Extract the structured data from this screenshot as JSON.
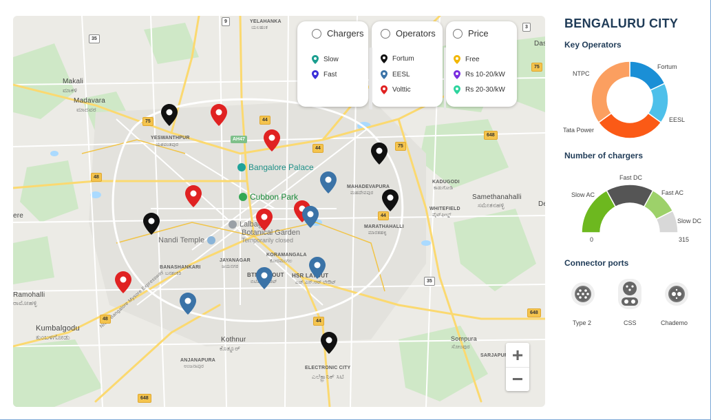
{
  "map": {
    "labels": {
      "yelahanka": "YELAHANKA",
      "yelahanka_kn": "ಯಲಹಂಕ",
      "makali": "Makali",
      "makali_kn": "ಮಾಕಳಿ",
      "madavara": "Madavara",
      "madavara_kn": "ಮಾದವರ",
      "yeswanthpur": "YESWANTHPUR",
      "yeswanthpur_kn": "ಯಶವಂತಪುರ",
      "mahadevapura": "MAHADEVAPURA",
      "mahadevapura_kn": "ಮಹದೇವಪುರ",
      "kadugodi": "KADUGODI",
      "kadugodi_kn": "ಕಾಡುಗೋಡಿ",
      "whitefield": "WHITEFIELD",
      "whitefield_kn": "ವೈಟ್‌ಫೀಲ್ಡ್",
      "samethanahalli": "Samethanahalli",
      "samethanahalli_kn": "ಸಮೇತನಹಳ್ಳಿ",
      "marathahalli": "MARATHAHALLI",
      "marathahalli_kn": "ಮಾರತಹಳ್ಳಿ",
      "banashankari": "BANASHANKARI",
      "banashankari_kn": "ಬನಶಂಕರಿ",
      "jayanagar": "JAYANAGAR",
      "jayanagar_kn": "ಜಯನಗರ",
      "koramangala": "KORAMANGALA",
      "koramangala_kn": "ಕೋರಮಂಗಲ",
      "btm": "BTM LAYOUT",
      "btm_kn": "ಬಿಟಿಎಂ ಲೇಔಟ್",
      "hsr": "HSR LAYOUT",
      "hsr_kn": "ಎಚ್‌.ಎಸ್‌.ಆರ್ ಲೇಔಟ್",
      "ramohalli": "Ramohalli",
      "ramohalli_kn": "ರಾಮೋಹಳ್ಳಿ",
      "kumbalgodu": "Kumbalgodu",
      "kumbalgodu_kn": "ಕುಂಬಳಗೋಡು",
      "kothnur": "Kothnur",
      "kothnur_kn": "ಕೊತ್ನೂರ್",
      "anjanapura": "ANJANAPURA",
      "anjanapura_kn": "ಅಂಜನಾಪುರ",
      "electronic_city": "ELECTRONIC CITY",
      "electronic_city_kn": "ಎಲೆಕ್ಟ್ರಾನಿಕ್ ಸಿಟಿ",
      "sompura": "Sompura",
      "sompura_kn": "ಸೋಂಪುರ",
      "sarjapur": "SARJAPUR",
      "nice_road": "NICE Bangalore Mysore Expressway",
      "das": "Das",
      "ere": "ere",
      "de": "De"
    },
    "pois": {
      "palace": "Bangalore Palace",
      "cubbon": "Cubbon Park",
      "lalbagh_1": "Lalbagh",
      "lalbagh_2": "Botanical Garden",
      "lalbagh_sub": "Temporarily closed",
      "nandi": "Nandi Temple"
    },
    "shields": [
      "9",
      "75",
      "44",
      "AH47",
      "44",
      "75",
      "48",
      "44",
      "35",
      "48",
      "648",
      "648",
      "648",
      "75",
      "44",
      "3",
      "35"
    ],
    "zoom": {
      "in": "+",
      "out": "−"
    }
  },
  "legend": {
    "chargers": {
      "title": "Chargers",
      "items": [
        {
          "label": "Slow",
          "color": "#1a9e8f"
        },
        {
          "label": "Fast",
          "color": "#3b2fd9"
        }
      ]
    },
    "operators": {
      "title": "Operators",
      "items": [
        {
          "label": "Fortum",
          "color": "#111111"
        },
        {
          "label": "EESL",
          "color": "#3b73a7"
        },
        {
          "label": "Volttic",
          "color": "#e02222"
        }
      ]
    },
    "price": {
      "title": "Price",
      "items": [
        {
          "label": "Free",
          "color": "#f2b705"
        },
        {
          "label": "Rs 10-20/kW",
          "color": "#7a2ee0"
        },
        {
          "label": "Rs 20-30/kW",
          "color": "#2ed49e"
        }
      ]
    }
  },
  "panel": {
    "city": "BENGALURU CITY",
    "key_operators_title": "Key Operators",
    "number_of_chargers_title": "Number of chargers",
    "connector_ports_title": "Connector ports",
    "operators_chart": {
      "type": "pie",
      "donut": true,
      "labels": [
        "Fortum",
        "EESL",
        "Tata Power",
        "NTPC"
      ],
      "values": [
        18,
        17,
        30,
        35
      ],
      "colors": [
        "#1a8fd6",
        "#4ec0ea",
        "#fb5a16",
        "#fb9f60"
      ]
    },
    "chargers_chart": {
      "type": "pie",
      "semi": true,
      "labels": [
        "Slow AC",
        "Fast DC",
        "Fast AC",
        "Slow DC"
      ],
      "values": [
        34,
        32,
        19,
        15
      ],
      "colors": [
        "#6db81f",
        "#555555",
        "#9dd16a",
        "#d8d8d8"
      ],
      "min_label": "0",
      "max_label": "315"
    },
    "ports": [
      {
        "label": "Type 2"
      },
      {
        "label": "CSS"
      },
      {
        "label": "Chademo"
      }
    ]
  }
}
